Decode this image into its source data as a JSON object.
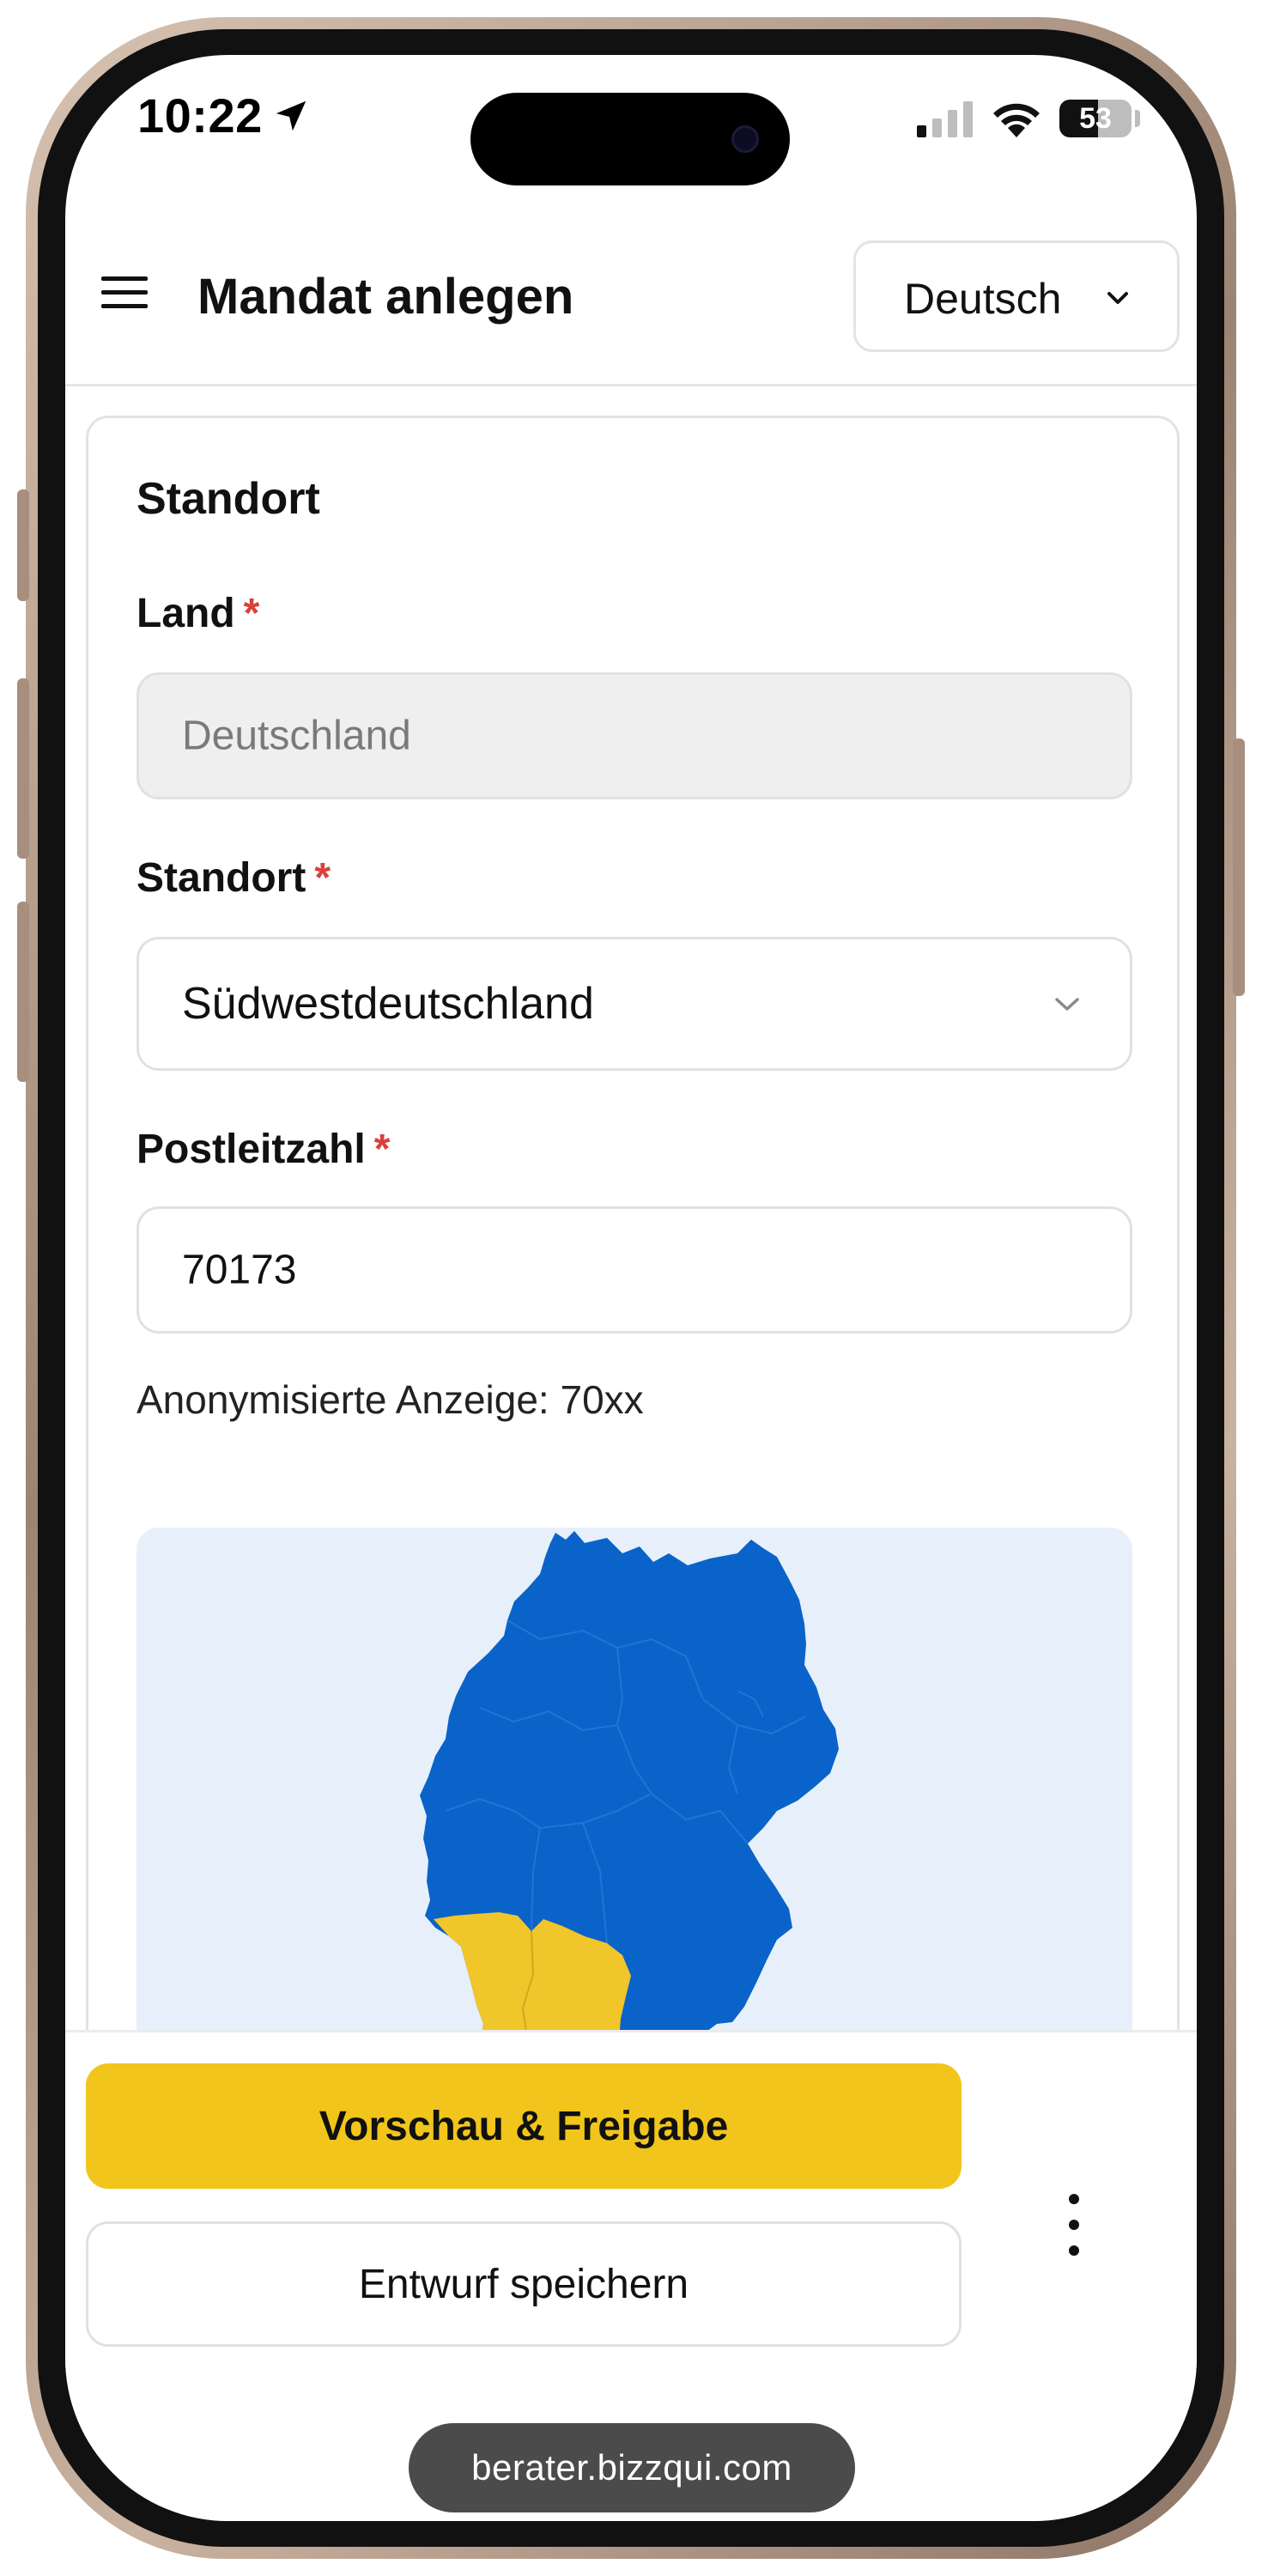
{
  "status_bar": {
    "time": "10:22",
    "battery": "53",
    "battery_level_percent": 53
  },
  "header": {
    "title": "Mandat anlegen",
    "language": "Deutsch"
  },
  "form": {
    "section_title": "Standort",
    "required_marker": "*",
    "country": {
      "label": "Land",
      "value": "Deutschland"
    },
    "location": {
      "label": "Standort",
      "value": "Südwestdeutschland"
    },
    "postal_code": {
      "label": "Postleitzahl",
      "value": "70173",
      "helper": "Anonymisierte Anzeige: 70xx"
    }
  },
  "map": {
    "base_color": "#0a63c9",
    "highlight_color": "#f0c62a",
    "background": "#e7f0fa",
    "highlighted_region": "Südwestdeutschland"
  },
  "actions": {
    "primary": "Vorschau & Freigabe",
    "secondary": "Entwurf speichern",
    "accent_color": "#f1c51b"
  },
  "browser": {
    "url": "berater.bizzqui.com"
  }
}
